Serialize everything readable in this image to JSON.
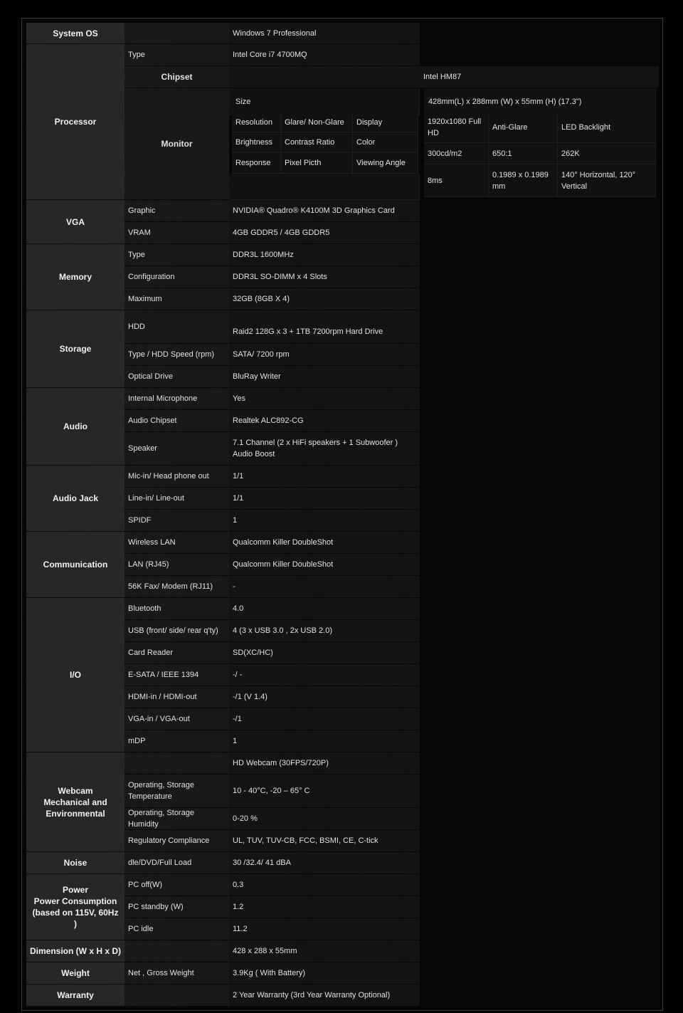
{
  "system_os": {
    "category": "System OS",
    "value": "Windows 7 Professional"
  },
  "processor": {
    "category": "Processor",
    "type_label": "Type",
    "type_value": "Intel Core i7 4700MQ",
    "chipset_label": "Chipset",
    "chipset_value": "Intel HM87",
    "monitor": {
      "label": "Monitor",
      "size_label": "Size",
      "size_value": "428mm(L) x 288mm (W) x 55mm (H) (17.3\")",
      "h1": [
        "Resolution",
        "Glare/ Non-Glare",
        "Display"
      ],
      "v1": [
        "1920x1080 Full HD",
        "Anti-Glare",
        "LED Backlight"
      ],
      "h2": [
        "Brightness",
        "Contrast Ratio",
        "Color"
      ],
      "v2": [
        "300cd/m2",
        "650:1",
        "262K"
      ],
      "h3": [
        "Response",
        "Pixel Picth",
        "Viewing Angle"
      ],
      "v3": [
        "8ms",
        "0.1989 x 0.1989 mm",
        "140° Horizontal, 120° Vertical"
      ]
    }
  },
  "vga": {
    "category": "VGA",
    "rows": [
      {
        "label": "Graphic",
        "value": "NVIDIA® Quadro® K4100M 3D Graphics Card"
      },
      {
        "label": "VRAM",
        "value": "4GB GDDR5 / 4GB GDDR5"
      }
    ]
  },
  "memory": {
    "category": "Memory",
    "rows": [
      {
        "label": "Type",
        "value": "DDR3L 1600MHz"
      },
      {
        "label": "Configuration",
        "value": "DDR3L SO-DIMM x 4 Slots"
      },
      {
        "label": "Maximum",
        "value": "32GB (8GB X 4)"
      }
    ]
  },
  "storage": {
    "category": "Storage",
    "rows": [
      {
        "label": "HDD",
        "value": "Raid2 128G x 3 + 1TB 7200rpm Hard Drive"
      },
      {
        "label": "Type / HDD Speed (rpm)",
        "value": "SATA/ 7200 rpm"
      },
      {
        "label": "Optical Drive",
        "value": "BluRay Writer"
      }
    ]
  },
  "audio": {
    "category": "Audio",
    "rows": [
      {
        "label": "Internal Microphone",
        "value": "Yes"
      },
      {
        "label": "Audio Chipset",
        "value": "Realtek ALC892-CG"
      },
      {
        "label": "Speaker",
        "value": "7.1 Channel (2 x HiFi speakers + 1 Subwoofer ) Audio Boost"
      }
    ]
  },
  "audio_jack": {
    "category": "Audio Jack",
    "rows": [
      {
        "label": "Mic-in/ Head phone out",
        "value": "1/1"
      },
      {
        "label": "Line-in/ Line-out",
        "value": "1/1"
      },
      {
        "label": "SPIDF",
        "value": "1"
      }
    ]
  },
  "communication": {
    "category": "Communication",
    "rows": [
      {
        "label": "Wireless LAN",
        "value": "Qualcomm Killer DoubleShot"
      },
      {
        "label": "LAN (RJ45)",
        "value": "Qualcomm Killer DoubleShot"
      },
      {
        "label": "56K Fax/ Modem (RJ11)",
        "value": "-"
      }
    ]
  },
  "io": {
    "category": "I/O",
    "rows": [
      {
        "label": "Bluetooth",
        "value": "4.0"
      },
      {
        "label": "USB (front/ side/ rear q'ty)",
        "value": "4 (3 x USB 3.0 , 2x USB 2.0)"
      },
      {
        "label": "Card Reader",
        "value": "SD(XC/HC)"
      },
      {
        "label": "E-SATA / IEEE 1394",
        "value": "-/ -"
      },
      {
        "label": "HDMI-in / HDMI-out",
        "value": "-/1 (V 1.4)"
      },
      {
        "label": "VGA-in / VGA-out",
        "value": "-/1"
      },
      {
        "label": "mDP",
        "value": "1"
      }
    ]
  },
  "webcam": {
    "category_1": "Webcam",
    "category_2": "Mechanical and",
    "category_3": "Environmental",
    "rows": [
      {
        "label": "",
        "value": "HD Webcam (30FPS/720P)"
      },
      {
        "label": "Operating, Storage Temperature",
        "value": "10 - 40°C, -20 – 65° C"
      },
      {
        "label": "Operating, Storage Humidity",
        "value": "0-20 %"
      },
      {
        "label": "Regulatory Compliance",
        "value": "UL, TUV, TUV-CB, FCC, BSMI, CE, C-tick"
      }
    ]
  },
  "noise": {
    "category": "Noise",
    "label": "dle/DVD/Full Load",
    "value": "30 /32.4/ 41 dBA"
  },
  "power": {
    "category_1": "Power",
    "category_2": "Power Consumption",
    "category_3": "(based on 115V, 60Hz )",
    "rows": [
      {
        "label": "PC off(W)",
        "value": "0.3"
      },
      {
        "label": "PC standby (W)",
        "value": "1.2"
      },
      {
        "label": "PC idle",
        "value": "11.2"
      }
    ]
  },
  "dimension": {
    "category": "Dimension (W x H x D)",
    "value": "428 x 288 x 55mm"
  },
  "weight": {
    "category": "Weight",
    "label": "Net , Gross Weight",
    "value": "3.9Kg ( With Battery)"
  },
  "warranty": {
    "category": "Warranty",
    "value": "2 Year Warranty (3rd Year Warranty Optional)"
  }
}
